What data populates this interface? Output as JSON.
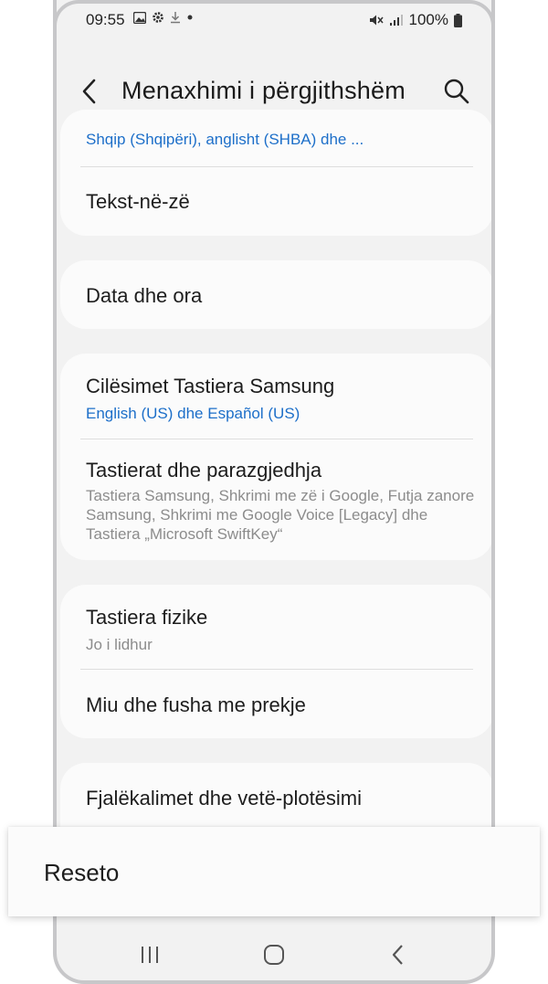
{
  "status_bar": {
    "time": "09:55",
    "battery": "100%",
    "icons_left": [
      "gallery-icon",
      "settings-icon",
      "download-icon",
      "dot-icon"
    ],
    "icons_right": [
      "mute-icon",
      "signal-icon",
      "battery-icon"
    ]
  },
  "header": {
    "title": "Menaxhimi i përgjithshëm"
  },
  "cards": [
    {
      "items": [
        {
          "subtitle": "Shqip (Shqipëri), anglisht (SHBA) dhe ..."
        },
        {
          "title": "Tekst-në-zë"
        }
      ]
    },
    {
      "items": [
        {
          "title": "Data dhe ora"
        }
      ]
    },
    {
      "items": [
        {
          "title": "Cilësimet Tastiera Samsung",
          "subtitle": "English (US) dhe Español (US)"
        },
        {
          "title": "Tastierat dhe parazgjedhja",
          "subtitle": "Tastiera Samsung, Shkrimi me zë i Google, Futja zanore Samsung, Shkrimi me Google Voice [Legacy] dhe Tastiera „Microsoft SwiftKey“"
        }
      ]
    },
    {
      "items": [
        {
          "title": "Tastiera fizike",
          "subtitle": "Jo i lidhur"
        },
        {
          "title": "Miu dhe fusha me prekje"
        }
      ]
    },
    {
      "items": [
        {
          "title": "Fjalëkalimet dhe vetë-plotësimi"
        }
      ]
    }
  ],
  "popup": {
    "label": "Reseto"
  },
  "colors": {
    "accent_blue": "#1d6fc9",
    "background": "#f2f2f2",
    "card": "#fbfbfb"
  }
}
